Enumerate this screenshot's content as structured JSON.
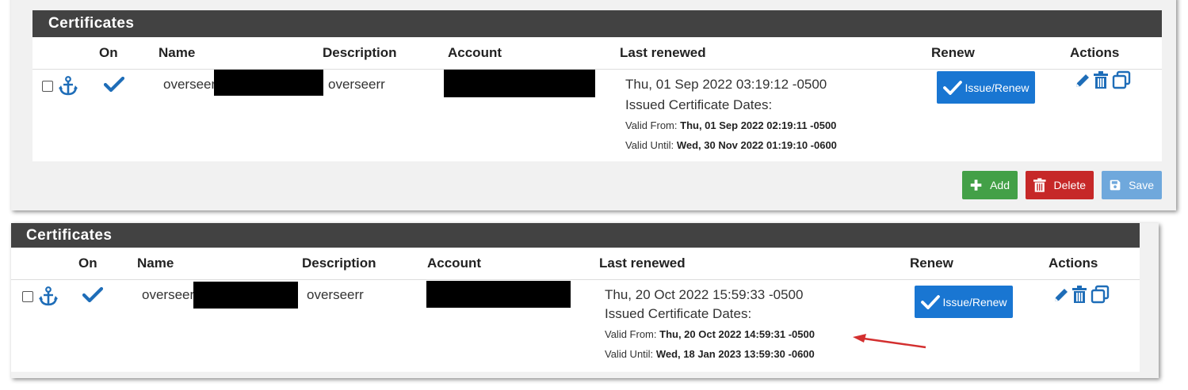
{
  "colors": {
    "header_bg": "#424242",
    "icon_blue": "#1e6db8",
    "issue_button": "#1976d2",
    "add_button": "#43a047",
    "delete_button": "#c62828",
    "save_button": "#6fa8dc",
    "arrow": "#d32f2f"
  },
  "panels": [
    {
      "title": "Certificates",
      "columns": {
        "on": "On",
        "name": "Name",
        "description": "Description",
        "account": "Account",
        "last_renewed": "Last renewed",
        "renew": "Renew",
        "actions": "Actions"
      },
      "row": {
        "name": "overseer",
        "description": "overseerr",
        "last_renewed": "Thu, 01 Sep 2022 03:19:12 -0500",
        "issued_label": "Issued Certificate Dates:",
        "valid_from_label": "Valid From:",
        "valid_from": "Thu, 01 Sep 2022 02:19:11 -0500",
        "valid_until_label": "Valid Until:",
        "valid_until": "Wed, 30 Nov 2022 01:19:10 -0600",
        "issue_button": "Issue/Renew"
      },
      "buttons": {
        "add": "Add",
        "delete": "Delete",
        "save": "Save"
      }
    },
    {
      "title": "Certificates",
      "columns": {
        "on": "On",
        "name": "Name",
        "description": "Description",
        "account": "Account",
        "last_renewed": "Last renewed",
        "renew": "Renew",
        "actions": "Actions"
      },
      "row": {
        "name": "overseer",
        "description": "overseerr",
        "last_renewed": "Thu, 20 Oct 2022 15:59:33 -0500",
        "issued_label": "Issued Certificate Dates:",
        "valid_from_label": "Valid From:",
        "valid_from": "Thu, 20 Oct 2022 14:59:31 -0500",
        "valid_until_label": "Valid Until:",
        "valid_until": "Wed, 18 Jan 2023 13:59:30 -0600",
        "issue_button": "Issue/Renew"
      }
    }
  ],
  "icons": [
    "anchor-icon",
    "check-icon",
    "pencil-icon",
    "trash-icon",
    "copy-icon",
    "plus-icon",
    "save-icon"
  ]
}
